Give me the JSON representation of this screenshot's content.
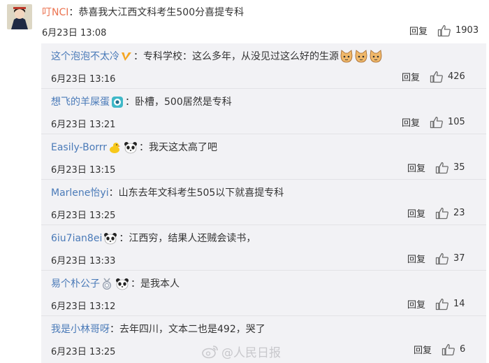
{
  "main": {
    "username": "叮NCI",
    "text": "：恭喜我大江西文科考生500分喜提专科",
    "date": "6月23日 13:08",
    "reply_label": "回复",
    "likes": "1903"
  },
  "replies": [
    {
      "username": "这个泡泡不太冷",
      "text": "：专科学校：这么多年，从没见过这么好的生源",
      "date": "6月23日 13:16",
      "reply_label": "回复",
      "likes": "426"
    },
    {
      "username": "想飞的羊屎蛋",
      "text": "：卧槽，500居然是专科",
      "date": "6月23日 13:21",
      "reply_label": "回复",
      "likes": "105"
    },
    {
      "username": "Easily-Borrr",
      "text": "：我天这太高了吧",
      "date": "6月23日 13:15",
      "reply_label": "回复",
      "likes": "35"
    },
    {
      "username": "Marlene怡yi",
      "text": "：山东去年文科考生505以下就喜提专科",
      "date": "6月23日 13:25",
      "reply_label": "回复",
      "likes": "23"
    },
    {
      "username": "6iu7ian8ei",
      "text": "：江西穷，结果人还贼会读书，",
      "date": "6月23日 13:33",
      "reply_label": "回复",
      "likes": "37"
    },
    {
      "username": "易个朴公子",
      "text": "：是我本人",
      "date": "6月23日 13:12",
      "reply_label": "回复",
      "likes": "14"
    },
    {
      "username": "我是小林哥呀",
      "text": "：去年四川，文本二也是492，哭了",
      "date": "6月23日 13:25",
      "reply_label": "回复",
      "likes": "6"
    }
  ],
  "watermark": "@人民日报",
  "icons": {
    "thumb": "thumbs-up-icon",
    "v_badge": "verified-v-icon",
    "panda": "panda-emoji-icon",
    "cat": "cat-emoji-icon",
    "duck": "duck-emoji-icon",
    "eye": "eye-badge-icon",
    "medal": "medal-badge-icon",
    "weibo": "weibo-logo-icon"
  },
  "colors": {
    "username_main": "#eb7350",
    "username_reply": "#4a7ab8",
    "reply_bg": "#f2f2f5"
  }
}
